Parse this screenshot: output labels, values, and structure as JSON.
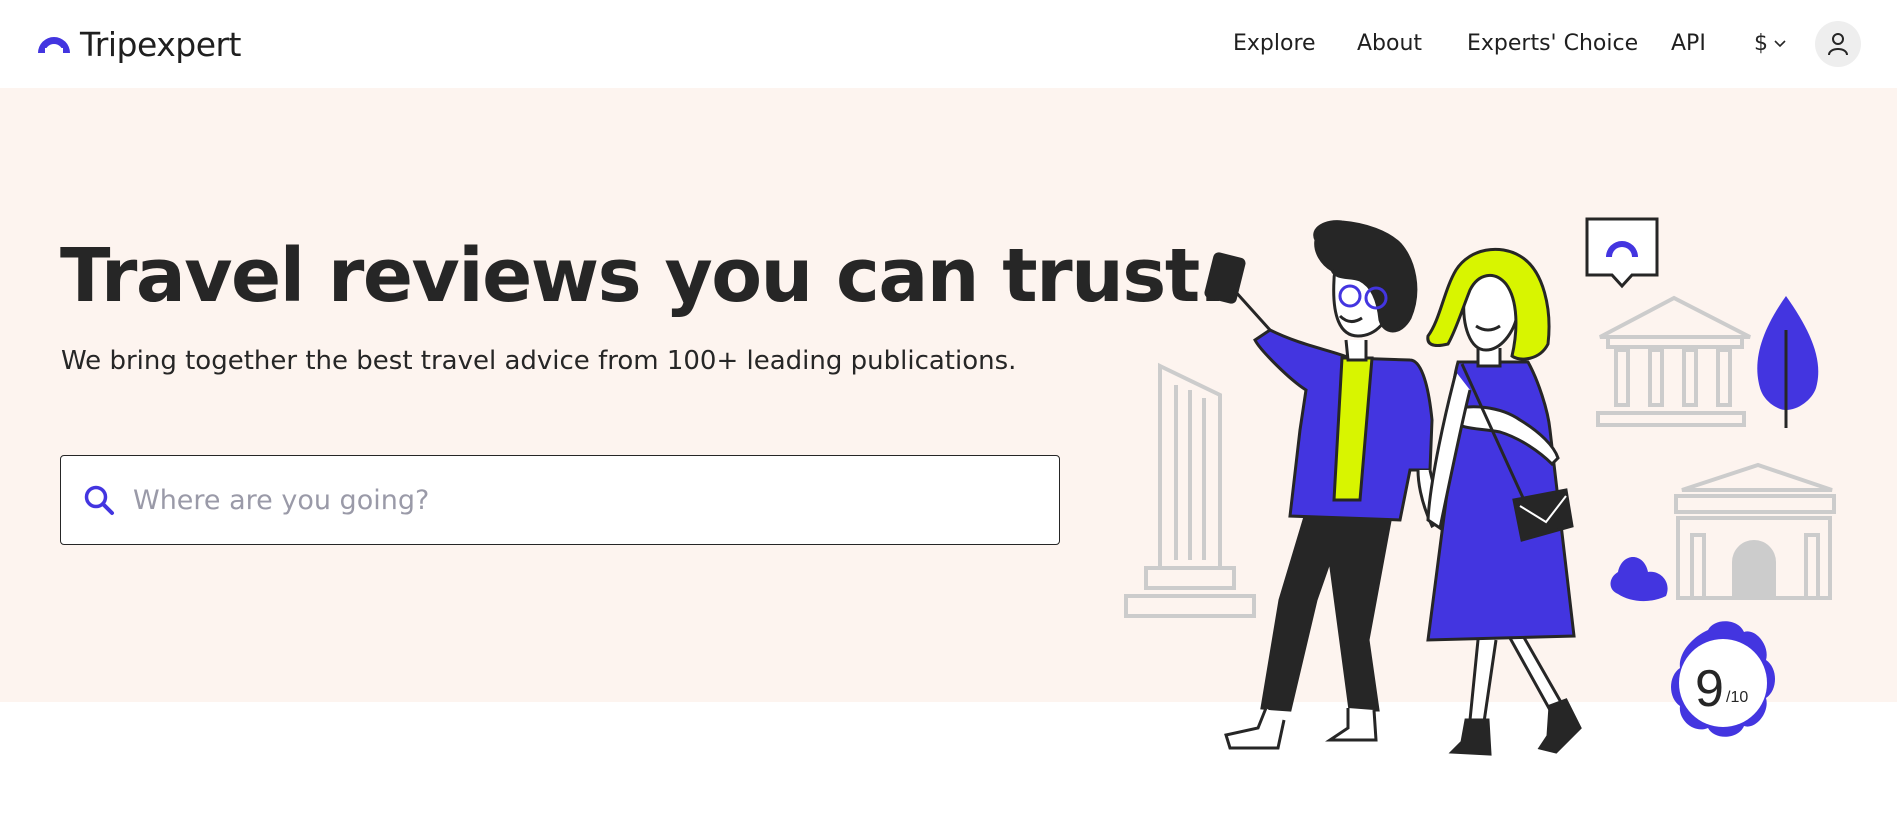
{
  "header": {
    "logo_text": "Tripexpert",
    "nav": [
      "Explore",
      "About",
      "Experts' Choice",
      "API"
    ],
    "currency": "$"
  },
  "hero": {
    "title": "Travel reviews you can trust.",
    "subtitle": "We bring together the best travel advice from 100+ leading publications.",
    "search_placeholder": "Where are you going?",
    "search_value": ""
  },
  "illustration": {
    "rating_value": "9",
    "rating_scale": "/10"
  },
  "colors": {
    "brand_blue": "#4335e0",
    "lime": "#d8f500",
    "hero_bg": "#fdf4ef",
    "outline_gray": "#cccccc"
  },
  "icons": [
    "logo-icon",
    "chevron-down-icon",
    "user-icon",
    "search-icon"
  ]
}
